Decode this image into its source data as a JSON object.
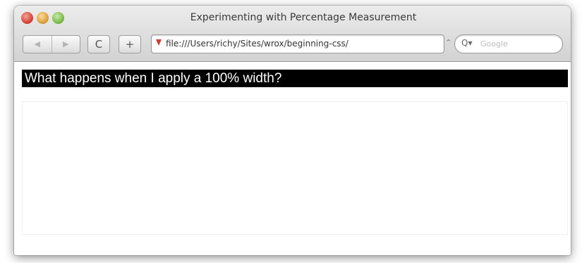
{
  "window": {
    "title": "Experimenting with Percentage Measurement"
  },
  "toolbar": {
    "back_icon": "back-arrow-icon",
    "forward_icon": "forward-arrow-icon",
    "back_glyph": "◀",
    "forward_glyph": "▶",
    "reload_glyph": "C",
    "add_bookmark_glyph": "+",
    "url": "file:///Users/richy/Sites/wrox/beginning-css/",
    "url_control_glyph": "⌃",
    "search_glyph": "Q▾",
    "search_placeholder": "Google"
  },
  "content": {
    "heading": "What happens when I apply a 100% width?"
  },
  "colors": {
    "heading_background": "#000000",
    "heading_text": "#ffffff",
    "close_button": "#d9473c",
    "minimize_button": "#e0a23a",
    "zoom_button": "#7dbf4c"
  }
}
